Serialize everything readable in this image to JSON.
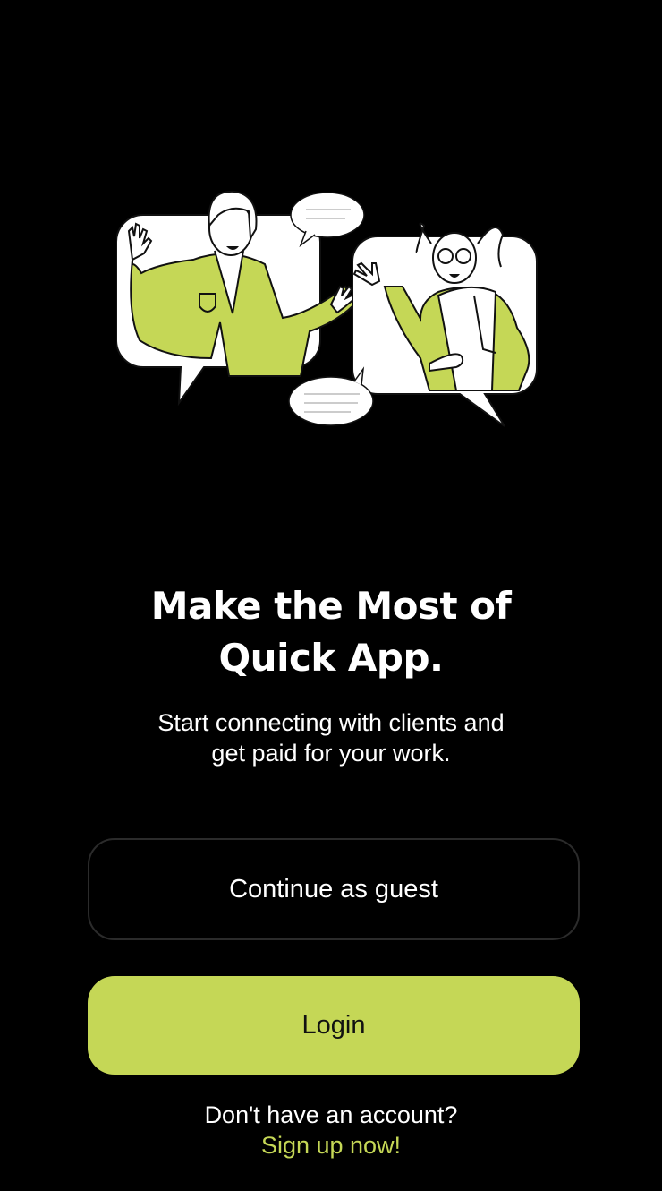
{
  "colors": {
    "background": "#000000",
    "accent": "#c5d756",
    "text": "#ffffff"
  },
  "illustration": {
    "icon": "two-people-chatting-illustration"
  },
  "headline": {
    "line1": "Make the Most of",
    "line2": "Quick App."
  },
  "subtitle": {
    "line1": "Start connecting with clients and",
    "line2": "get paid for your work."
  },
  "buttons": {
    "guest_label": "Continue as guest",
    "login_label": "Login"
  },
  "footer": {
    "question": "Don't have an account?",
    "signup_label": "Sign up now!"
  }
}
